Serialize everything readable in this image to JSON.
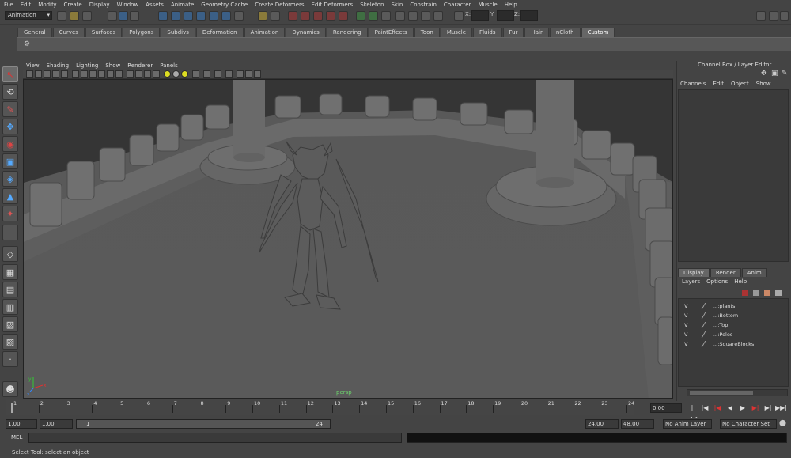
{
  "menubar": {
    "items": [
      "File",
      "Edit",
      "Modify",
      "Create",
      "Display",
      "Window",
      "Assets",
      "Animate",
      "Geometry Cache",
      "Create Deformers",
      "Edit Deformers",
      "Skeleton",
      "Skin",
      "Constrain",
      "Character",
      "Muscle",
      "Help"
    ]
  },
  "statusline": {
    "mode": "Animation",
    "x_label": "X:",
    "y_label": "Y:",
    "z_label": "Z:"
  },
  "shelf": {
    "tabs": [
      "General",
      "Curves",
      "Surfaces",
      "Polygons",
      "Subdivs",
      "Deformation",
      "Animation",
      "Dynamics",
      "Rendering",
      "PaintEffects",
      "Toon",
      "Muscle",
      "Fluids",
      "Fur",
      "Hair",
      "nCloth",
      "Custom"
    ],
    "active_tab": "Custom"
  },
  "viewport": {
    "menu": [
      "View",
      "Shading",
      "Lighting",
      "Show",
      "Renderer",
      "Panels"
    ],
    "camera_label": "persp",
    "axis_x": "x",
    "axis_y": "y",
    "axis_z": "z"
  },
  "channel_box": {
    "title": "Channel Box / Layer Editor",
    "menu": [
      "Channels",
      "Edit",
      "Object",
      "Show"
    ]
  },
  "layer_editor": {
    "tabs": [
      "Display",
      "Render",
      "Anim"
    ],
    "active_tab": "Display",
    "menu": [
      "Layers",
      "Options",
      "Help"
    ],
    "layers": [
      {
        "visible": "V",
        "name": "...:plants"
      },
      {
        "visible": "V",
        "name": "...:Bottom"
      },
      {
        "visible": "V",
        "name": "...:Top"
      },
      {
        "visible": "V",
        "name": "...:Poles"
      },
      {
        "visible": "V",
        "name": "...:SquareBlocks"
      }
    ]
  },
  "time_slider": {
    "ticks": [
      "1",
      "2",
      "3",
      "4",
      "5",
      "6",
      "7",
      "8",
      "9",
      "10",
      "11",
      "12",
      "13",
      "14",
      "15",
      "16",
      "17",
      "18",
      "19",
      "20",
      "21",
      "22",
      "23",
      "24"
    ],
    "current_frame": "0.00"
  },
  "range_slider": {
    "start": "1.00",
    "playback_start": "1.00",
    "slider_start": "1",
    "slider_end": "24",
    "playback_end": "24.00",
    "end": "48.00",
    "anim_layer": "No Anim Layer",
    "character_set": "No Character Set"
  },
  "command_line": {
    "label": "MEL"
  },
  "help_line": {
    "text": "Select Tool: select an object"
  },
  "colors": {
    "background": "#444444",
    "viewport_bg": "#2e2e2e",
    "camera_label": "#6cd46c",
    "active_tool": "#6a6a6a"
  }
}
